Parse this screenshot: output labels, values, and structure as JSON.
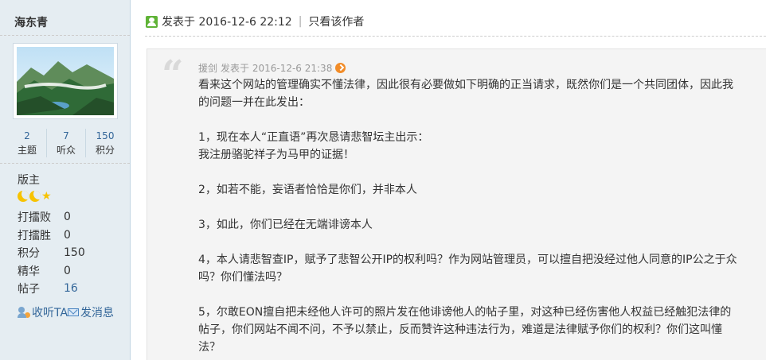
{
  "author": {
    "name": "海东青",
    "stats": [
      {
        "num": "2",
        "label": "主题"
      },
      {
        "num": "7",
        "label": "听众"
      },
      {
        "num": "150",
        "label": "积分"
      }
    ],
    "rank": "版主",
    "profile": [
      {
        "key": "打擂败",
        "value": "0"
      },
      {
        "key": "打擂胜",
        "value": "0"
      },
      {
        "key": "积分",
        "value": "150"
      },
      {
        "key": "精华",
        "value": "0"
      },
      {
        "key": "帖子",
        "value": "16"
      }
    ],
    "follow_label": "收听TA",
    "message_label": "发消息"
  },
  "post": {
    "posted_label": "发表于 2016-12-6 22:12",
    "separator": "|",
    "only_author_label": "只看该作者"
  },
  "quote": {
    "mark": "“",
    "author": "援剑",
    "time": "发表于 2016-12-6 21:38",
    "paragraphs": [
      {
        "lines": [
          "看来这个网站的管理确实不懂法律，因此很有必要做如下明确的正当请求，既然你们是一个共同团体，因此我",
          "的问题一并在此发出："
        ]
      },
      {
        "lines": [
          "1，现在本人“正直语”再次恳请悲智坛主出示：",
          "我注册骆驼祥子为马甲的证据！"
        ]
      },
      {
        "lines": [
          "2，如若不能，妄语者恰恰是你们，并非本人"
        ]
      },
      {
        "lines": [
          "3，如此，你们已经在无端诽谤本人"
        ]
      },
      {
        "lines": [
          "4，本人请悲智查IP，赋予了悲智公开IP的权利吗？作为网站管理员，可以擅自把没经过他人同意的IP公之于众",
          "吗？你们懂法吗？"
        ]
      },
      {
        "lines": [
          "5，尔敢EON擅自把未经他人许可的照片发在他诽谤他人的帖子里，对这种已经伤害他人权益已经触犯法律的",
          "帖子，你们网站不闻不问，不予以禁止，反而赞许这种违法行为，难道是法律赋予你们的权利？你们这叫懂",
          "法？"
        ]
      }
    ]
  },
  "colors": {
    "sidebar_bg": "#e5edf2",
    "link": "#336699",
    "quote_bg": "#f4f4f4",
    "star": "#f7c300"
  }
}
